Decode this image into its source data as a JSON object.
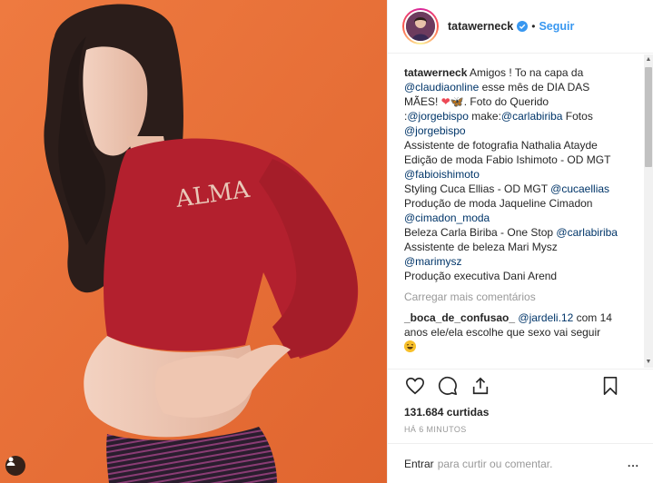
{
  "post": {
    "username": "tatawerneck",
    "follow_label": "Seguir",
    "dot": "•",
    "verified_icon": "verified-badge-icon",
    "photo_print_text": "ALMA",
    "caption_lines": [
      {
        "user": "tatawerneck",
        "text": " Amigos ! To na capa da"
      },
      {
        "mention": "@claudiaonline",
        "text": " esse mês de DIA DAS"
      },
      {
        "text": "MÃES! ",
        "heart": "❤",
        "butterfly": "🦋",
        "text2": ". Foto do Querido"
      },
      {
        "text": ":",
        "mention": "@jorgebispo",
        "text2": " make:",
        "mention2": "@carlabiriba",
        "text3": " Fotos"
      },
      {
        "mention": "@jorgebispo"
      },
      {
        "text": "Assistente de fotografia Nathalia Atayde"
      },
      {
        "text": "Edição de moda Fabio Ishimoto - OD MGT"
      },
      {
        "mention": "@fabioishimoto"
      },
      {
        "text": "Styling Cuca Ellias - OD MGT ",
        "mention": "@cucaellias"
      },
      {
        "text": "Produção de moda Jaqueline Cimadon"
      },
      {
        "mention": "@cimadon_moda"
      },
      {
        "text": "Beleza Carla Biriba - One Stop ",
        "mention": "@carlabiriba"
      },
      {
        "text": "Assistente de beleza Mari Mysz"
      },
      {
        "mention": "@marimysz"
      },
      {
        "text": "Produção executiva Dani Arend"
      }
    ],
    "load_more": "Carregar mais comentários",
    "comment": {
      "user": "_boca_de_confusao_",
      "mention": "@jardeli.12",
      "text_line1": " com 14",
      "text_line2": "anos ele/ela escolhe que sexo vai seguir"
    },
    "likes": "131.684 curtidas",
    "time": "HÁ 6 MINUTOS",
    "login_label": "Entrar",
    "login_rest": "para curtir ou comentar.",
    "more_label": "...",
    "scroll_up": "▲",
    "scroll_down": "▼"
  },
  "colors": {
    "background": "#e8703a",
    "link": "#3897f0",
    "mention": "#003569",
    "muted": "#999999",
    "sweater": "#b3202e"
  },
  "icons": [
    "heart-icon",
    "comment-icon",
    "share-icon",
    "bookmark-icon",
    "user-tag-icon",
    "laughing-emoji-icon"
  ]
}
